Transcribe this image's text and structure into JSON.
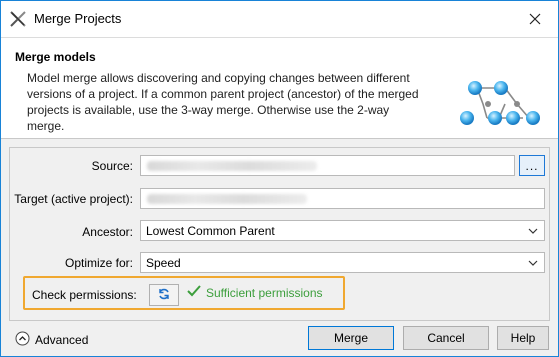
{
  "window": {
    "title": "Merge Projects",
    "close_label": "Close"
  },
  "header": {
    "title": "Merge models",
    "description": "Model merge allows discovering and copying changes between different versions of a project. If a common parent project (ancestor) of the merged projects is available, use the 3-way merge. Otherwise use the 2-way merge."
  },
  "form": {
    "source": {
      "label": "Source:",
      "browse_label": "..."
    },
    "target": {
      "label": "Target (active project):"
    },
    "ancestor": {
      "label": "Ancestor:",
      "value": "Lowest Common Parent"
    },
    "optimize": {
      "label": "Optimize for:",
      "value": "Speed"
    },
    "permissions": {
      "label": "Check permissions:",
      "status": "Sufficient permissions"
    }
  },
  "footer": {
    "advanced_label": "Advanced",
    "merge_label": "Merge",
    "cancel_label": "Cancel",
    "help_label": "Help"
  },
  "colors": {
    "accent": "#1883d7",
    "highlight": "#f0a830",
    "success": "#3c9e3c"
  }
}
